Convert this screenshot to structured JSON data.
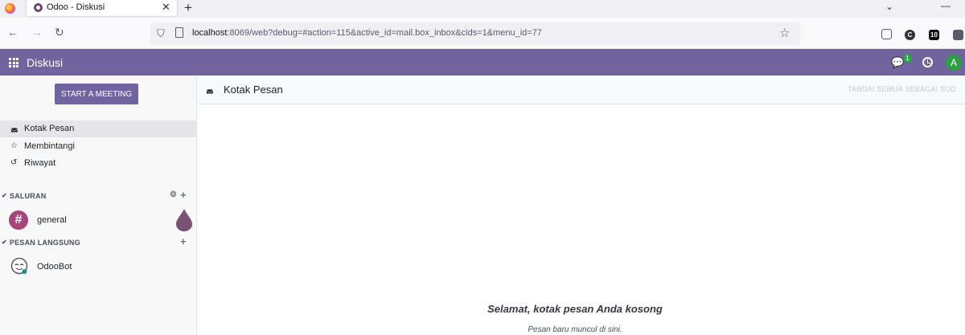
{
  "browser": {
    "tab_title": "Odoo - Diskusi",
    "url_host": "localhost",
    "url_rest": ":8069/web?debug=#action=115&active_id=mail.box_inbox&cids=1&menu_id=77"
  },
  "navbar": {
    "app_name": "Diskusi",
    "chat_badge": "1",
    "user_initial": "A",
    "brand_color": "#71639e"
  },
  "sidebar": {
    "start_meeting": "START A MEETING",
    "items": [
      {
        "label": "Kotak Pesan",
        "icon": "inbox-icon"
      },
      {
        "label": "Membintangi",
        "icon": "star-icon"
      },
      {
        "label": "Riwayat",
        "icon": "history-icon"
      }
    ],
    "channels_header": "SALURAN",
    "channels": [
      {
        "name": "general"
      }
    ],
    "direct_header": "PESAN LANGSUNG",
    "direct": [
      {
        "name": "OdooBot"
      }
    ]
  },
  "main": {
    "title": "Kotak Pesan",
    "mark_all": "TANDAI SEMUA SEBAGAI SUD",
    "empty_title": "Selamat, kotak pesan Anda kosong",
    "empty_subtitle": "Pesan baru muncul di sini."
  }
}
